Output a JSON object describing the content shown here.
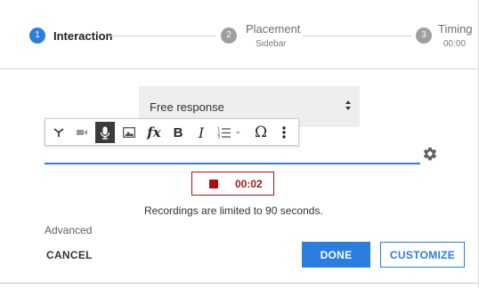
{
  "stepper": {
    "steps": [
      {
        "number": "1",
        "title": "Interaction",
        "subtitle": "",
        "state": "active"
      },
      {
        "number": "2",
        "title": "Placement",
        "subtitle": "Sidebar",
        "state": "inactive"
      },
      {
        "number": "3",
        "title": "Timing",
        "subtitle": "00:00",
        "state": "inactive"
      }
    ]
  },
  "response_type": {
    "selected": "Free response"
  },
  "toolbar": {
    "buttons": [
      {
        "name": "audio-wave-icon",
        "glyph": "Y"
      },
      {
        "name": "video-camera-icon",
        "glyph": ""
      },
      {
        "name": "microphone-icon",
        "glyph": "",
        "active": true
      },
      {
        "name": "image-icon",
        "glyph": ""
      },
      {
        "name": "formula-icon",
        "glyph": "fx"
      },
      {
        "name": "bold-icon",
        "glyph": "B"
      },
      {
        "name": "italic-icon",
        "glyph": "I"
      },
      {
        "name": "numbered-list-icon",
        "glyph": ""
      },
      {
        "name": "special-character-icon",
        "glyph": "Ω"
      },
      {
        "name": "more-vert-icon",
        "glyph": ""
      }
    ]
  },
  "recording": {
    "elapsed": "00:02",
    "limit_note": "Recordings are limited to 90 seconds."
  },
  "advanced_label": "Advanced",
  "footer": {
    "cancel_label": "CANCEL",
    "done_label": "DONE",
    "customize_label": "CUSTOMIZE"
  },
  "colors": {
    "accent": "#2b7de0",
    "record_red": "#b00e0e",
    "inactive_step": "#9e9e9e"
  }
}
